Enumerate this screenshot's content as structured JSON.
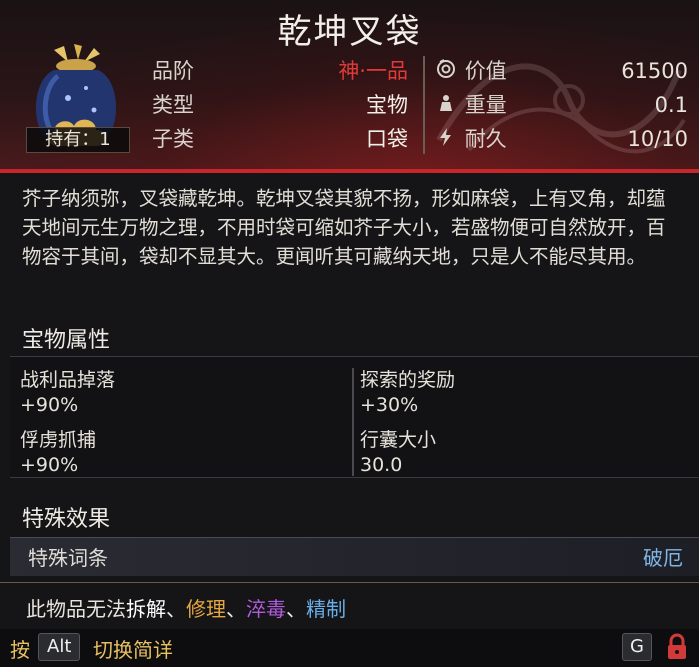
{
  "item": {
    "name": "乾坤叉袋",
    "hold_count": "持有：1",
    "left_stats": [
      {
        "label": "品阶",
        "value": "神·一品",
        "value_color": "#e23a3a"
      },
      {
        "label": "类型",
        "value": "宝物",
        "value_color": "#f2efe9"
      },
      {
        "label": "子类",
        "value": "口袋",
        "value_color": "#f2efe9"
      }
    ],
    "right_stats": [
      {
        "icon": "coin-icon",
        "label": "价值",
        "value": "61500"
      },
      {
        "icon": "weight-icon",
        "label": "重量",
        "value": "0.1"
      },
      {
        "icon": "durability-icon",
        "label": "耐久",
        "value": "10/10"
      }
    ],
    "description": "芥子纳须弥，叉袋藏乾坤。乾坤叉袋其貌不扬，形如麻袋，上有叉角，却蕴天地间元生万物之理，不用时袋可缩如芥子大小，若盛物便可自然放开，百物容于其间，袋却不显其大。更闻听其可藏纳天地，只是人不能尽其用。"
  },
  "attributes": {
    "title": "宝物属性",
    "cells": [
      {
        "name": "战利品掉落",
        "value": "+90%"
      },
      {
        "name": "探索的奖励",
        "value": "+30%"
      },
      {
        "name": "俘虏抓捕",
        "value": "+90%"
      },
      {
        "name": "行囊大小",
        "value": "30.0"
      }
    ]
  },
  "special": {
    "title": "特殊效果",
    "row_label": "特殊词条",
    "row_value": "破厄",
    "row_value_color": "#7fb6e6"
  },
  "footer": {
    "prefix": "此物品无法",
    "actions": [
      {
        "text": "拆解",
        "color": "#ffffff"
      },
      {
        "text": "修理",
        "color": "#e8a640"
      },
      {
        "text": "淬毒",
        "color": "#b25ce0"
      },
      {
        "text": "精制",
        "color": "#6aaee6"
      }
    ],
    "separator": "、"
  },
  "hint": {
    "press": "按",
    "key": "Alt",
    "action": "切换简详",
    "key2": "G",
    "press_color": "#e8c060"
  }
}
